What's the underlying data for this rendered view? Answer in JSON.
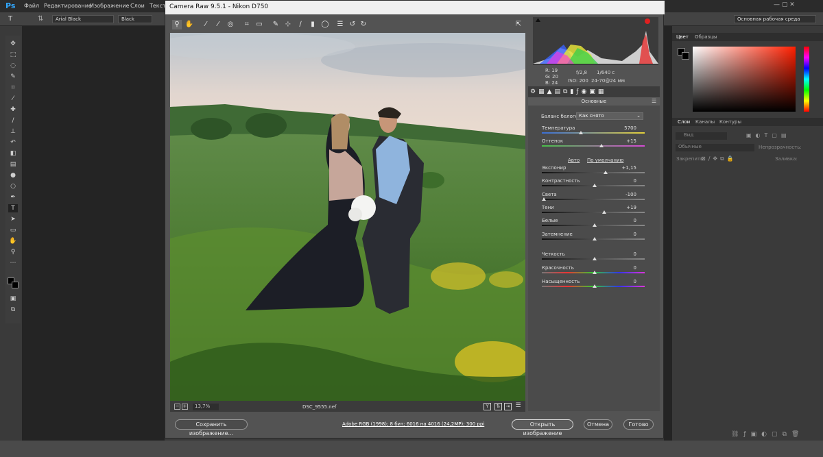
{
  "app": {
    "logo": "Ps",
    "menu": [
      "Файл",
      "Редактирование",
      "Изображение",
      "Слои",
      "Текст"
    ]
  },
  "options": {
    "font_family": "Arial Black",
    "font_style": "Black",
    "workspace": "Основная рабочая среда"
  },
  "dialog": {
    "title": "Camera Raw 9.5.1  -  Nikon D750",
    "zoom": "13,7%",
    "filename": "DSC_9555.nef",
    "info": {
      "r": "R: 19",
      "g": "G: 20",
      "b": "B: 24",
      "aperture": "f/2,8",
      "shutter": "1/640 с",
      "iso": "ISO: 200",
      "lens": "24-70@24 мм"
    },
    "section_title": "Основные",
    "wb_label": "Баланс белого:",
    "wb_value": "Как снято",
    "auto_link": "Авто",
    "default_link": "По умолчанию",
    "sliders": [
      {
        "label": "Температура",
        "value": "5700",
        "pos": 0.37
      },
      {
        "label": "Оттенок",
        "value": "+15",
        "pos": 0.57
      },
      {
        "label": "Экспонир",
        "value": "+1,15",
        "pos": 0.61
      },
      {
        "label": "Контрастность",
        "value": "0",
        "pos": 0.5
      },
      {
        "label": "Света",
        "value": "-100",
        "pos": 0.0
      },
      {
        "label": "Тени",
        "value": "+19",
        "pos": 0.6
      },
      {
        "label": "Белые",
        "value": "0",
        "pos": 0.5
      },
      {
        "label": "Затемнение",
        "value": "0",
        "pos": 0.5
      },
      {
        "label": "Четкость",
        "value": "0",
        "pos": 0.5
      },
      {
        "label": "Красочность",
        "value": "0",
        "pos": 0.5
      },
      {
        "label": "Насыщенность",
        "value": "0",
        "pos": 0.5
      }
    ],
    "save_btn": "Сохранить изображение...",
    "workflow_link": "Adobe RGB (1998); 8 бит; 6016 на 4016 (24,2MP); 300 ppi",
    "open_btn": "Открыть изображение",
    "cancel_btn": "Отмена",
    "done_btn": "Готово"
  },
  "panels": {
    "color_tabs": [
      "Цвет",
      "Образцы"
    ],
    "layer_tabs": [
      "Слои",
      "Каналы",
      "Контуры"
    ],
    "search": "Вид",
    "blend": "Обычные",
    "opacity": "Непрозрачность:",
    "lock": "Закрепить:",
    "fill": "Заливка:"
  }
}
